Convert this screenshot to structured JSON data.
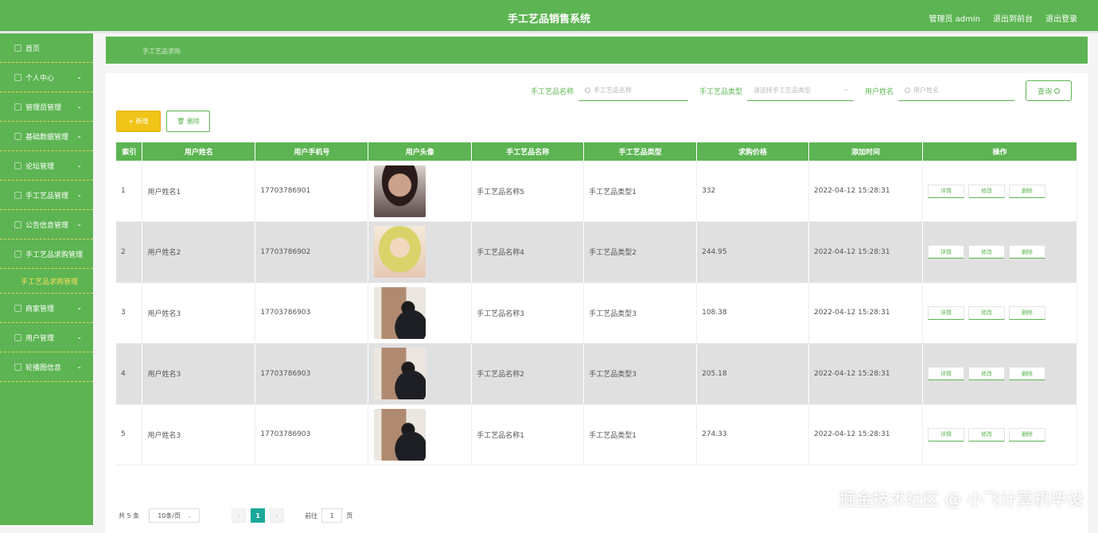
{
  "header": {
    "title": "手工艺品销售系统",
    "admin_label": "管理员 admin",
    "back_label": "退出到前台",
    "logout_label": "退出登录"
  },
  "sidebar": {
    "items": [
      {
        "label": "首页",
        "chevron": ""
      },
      {
        "label": "个人中心",
        "chevron": "⌄"
      },
      {
        "label": "管理员管理",
        "chevron": "⌄"
      },
      {
        "label": "基础数据管理",
        "chevron": "⌄"
      },
      {
        "label": "论坛管理",
        "chevron": "⌄"
      },
      {
        "label": "手工艺品管理",
        "chevron": "⌄"
      },
      {
        "label": "公告信息管理",
        "chevron": "⌄"
      },
      {
        "label": "手工艺品求购管理",
        "chevron": ""
      },
      {
        "label": "手工艺品求购管理",
        "chevron": ""
      },
      {
        "label": "商家管理",
        "chevron": "⌄"
      },
      {
        "label": "用户管理",
        "chevron": "⌄"
      },
      {
        "label": "轮播图信息",
        "chevron": "⌄"
      }
    ]
  },
  "breadcrumb": {
    "text": "手工艺品求购"
  },
  "search": {
    "name_label": "手工艺品名称",
    "name_placeholder": "手工艺品名称",
    "type_label": "手工艺品类型",
    "type_placeholder": "请选择手工艺品类型",
    "user_label": "用户姓名",
    "user_placeholder": "用户姓名",
    "button": "查询"
  },
  "actions": {
    "add": "+ 新增",
    "delete": "删除"
  },
  "table": {
    "headers": [
      "索引",
      "用户姓名",
      "用户手机号",
      "用户头像",
      "手工艺品名称",
      "手工艺品类型",
      "求购价格",
      "添加时间",
      "操作"
    ],
    "rows": [
      {
        "idx": "1",
        "name": "用户姓名1",
        "phone": "17703786901",
        "item": "手工艺品名称5",
        "type": "手工艺品类型1",
        "price": "332",
        "time": "2022-04-12 15:28:31"
      },
      {
        "idx": "2",
        "name": "用户姓名2",
        "phone": "17703786902",
        "item": "手工艺品名称4",
        "type": "手工艺品类型2",
        "price": "244.95",
        "time": "2022-04-12 15:28:31"
      },
      {
        "idx": "3",
        "name": "用户姓名3",
        "phone": "17703786903",
        "item": "手工艺品名称3",
        "type": "手工艺品类型3",
        "price": "108.38",
        "time": "2022-04-12 15:28:31"
      },
      {
        "idx": "4",
        "name": "用户姓名3",
        "phone": "17703786903",
        "item": "手工艺品名称2",
        "type": "手工艺品类型3",
        "price": "205.18",
        "time": "2022-04-12 15:28:31"
      },
      {
        "idx": "5",
        "name": "用户姓名3",
        "phone": "17703786903",
        "item": "手工艺品名称1",
        "type": "手工艺品类型1",
        "price": "274.33",
        "time": "2022-04-12 15:28:31"
      }
    ],
    "ops": {
      "detail": "详情",
      "edit": "修改",
      "del": "删除"
    }
  },
  "pager": {
    "total": "共 5 条",
    "size": "10条/页",
    "page": "1",
    "goto": "前往",
    "goto_value": "1",
    "page_suffix": "页"
  },
  "watermark": "掘金技术社区 @ 小飞计算机毕设"
}
